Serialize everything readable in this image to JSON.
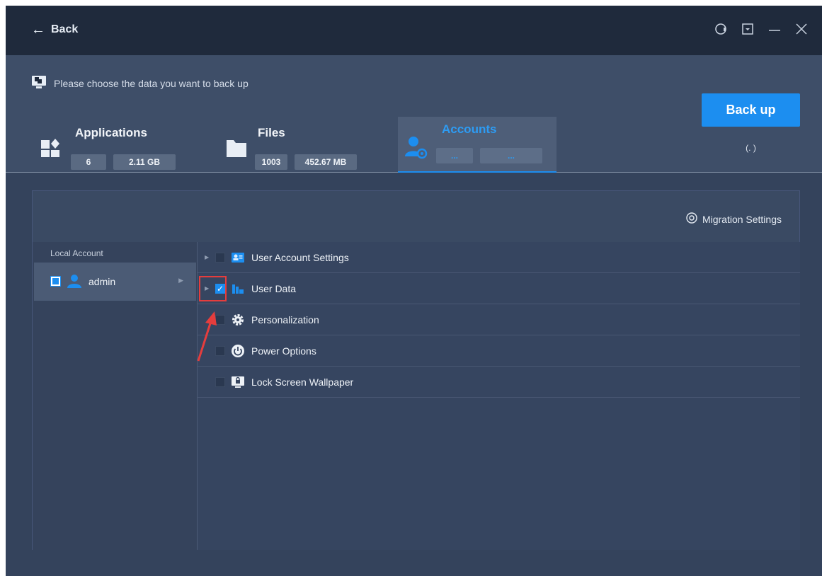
{
  "titlebar": {
    "back_label": "Back"
  },
  "header": {
    "prompt": "Please choose the data you want to back up",
    "categories": [
      {
        "title": "Applications",
        "badges": [
          "6",
          "2.11 GB"
        ]
      },
      {
        "title": "Files",
        "badges": [
          "1003",
          "452.67 MB"
        ]
      },
      {
        "title": "Accounts",
        "badges": [
          "...",
          "..."
        ],
        "selected": true
      }
    ],
    "backup_button": "Back up",
    "backup_status": "(. )"
  },
  "panel": {
    "migration_settings": "Migration Settings",
    "left_title": "Local Account",
    "account": {
      "name": "admin",
      "checked": true
    },
    "items": [
      {
        "label": "User Account Settings",
        "checked": false
      },
      {
        "label": "User Data",
        "checked": true
      },
      {
        "label": "Personalization",
        "checked": false
      },
      {
        "label": "Power Options",
        "checked": false
      },
      {
        "label": "Lock Screen Wallpaper",
        "checked": false
      }
    ]
  },
  "colors": {
    "accent": "#1c8ef0",
    "annotation": "#e53d3d"
  },
  "icons": {
    "window_controls": [
      "support-icon",
      "dropdown-icon",
      "minimize-icon",
      "close-icon"
    ]
  }
}
